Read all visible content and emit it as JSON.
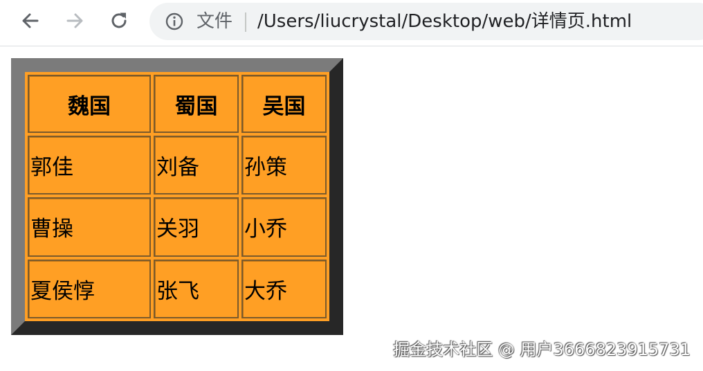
{
  "browser": {
    "back_icon": "arrow-left-icon",
    "forward_icon": "arrow-right-icon",
    "reload_icon": "reload-icon",
    "info_icon": "info-icon",
    "scheme_label": "文件",
    "url": "/Users/liucrystal/Desktop/web/详情页.html"
  },
  "table": {
    "headers": [
      "魏国",
      "蜀国",
      "吴国"
    ],
    "rows": [
      [
        "郭佳",
        "刘备",
        "孙策"
      ],
      [
        "曹操",
        "关羽",
        "小乔"
      ],
      [
        "夏侯惇",
        "张飞",
        "大乔"
      ]
    ],
    "colors": {
      "cell_background": "#ff9f24",
      "outer_border_light": "#7b7b7b",
      "outer_border_dark": "#272727"
    }
  },
  "watermark": {
    "text": "掘金技术社区 @ 用户3666823915731"
  }
}
